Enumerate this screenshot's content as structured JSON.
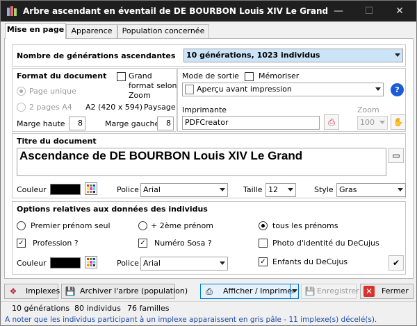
{
  "window": {
    "title": "Arbre ascendant en éventail de DE BOURBON Louis XIV Le Grand"
  },
  "tabs": [
    {
      "label": "Mise en page",
      "active": true
    },
    {
      "label": "Apparence",
      "active": false
    },
    {
      "label": "Population concernée",
      "active": false
    }
  ],
  "generations": {
    "label": "Nombre de générations ascendantes",
    "value": "10 générations, 1023 individus"
  },
  "format": {
    "heading": "Format du document",
    "grand_format_label": "Grand format selon Zoom",
    "page_unique": "Page unique",
    "pages_a4": "2 pages A4",
    "paper": "A2 (420 x 594)",
    "orientation": "Paysage",
    "marge_haute_label": "Marge haute",
    "marge_haute": "8",
    "marge_gauche_label": "Marge gauche",
    "marge_gauche": "8"
  },
  "output": {
    "mode_label": "Mode de sortie",
    "memoriser_label": "Mémoriser",
    "mode_value": "Aperçu avant impression",
    "printer_label": "Imprimante",
    "printer_value": "PDFCreator",
    "zoom_label": "Zoom",
    "zoom_value": "100"
  },
  "title_doc": {
    "heading": "Titre du document",
    "value": "Ascendance de DE BOURBON Louis XIV Le Grand",
    "couleur_label": "Couleur",
    "police_label": "Police",
    "police_value": "Arial",
    "taille_label": "Taille",
    "taille_value": "12",
    "style_label": "Style",
    "style_value": "Gras"
  },
  "options": {
    "heading": "Options relatives aux données des individus",
    "premier_prenom": "Premier prénom seul",
    "deuxieme_prenom": "+ 2ème prénom",
    "tous_prenoms": "tous les prénoms",
    "profession": "Profession ?",
    "numero_sosa": "Numéro Sosa ?",
    "photo_decujus": "Photo d'identité du DeCujus",
    "enfants_decujus": "Enfants du DeCujus",
    "couleur_label": "Couleur",
    "police_label": "Police",
    "police_value": "Arial"
  },
  "buttons": {
    "implexes": "Implexes",
    "archiver": "Archiver l'arbre (population)",
    "afficher": "Afficher / Imprimer",
    "enregistrer": "Enregistrer",
    "fermer": "Fermer"
  },
  "status": {
    "generations": "10 générations",
    "individus": "80 individus",
    "familles": "76 familles",
    "note": "A noter que les individus participant à un implexe apparaissent en gris pâle - 11 implexe(s) décelé(s)."
  },
  "colors": {
    "accent": "#1f4aa8",
    "selected_bg": "#cce4f7",
    "title_bar": "#1f1f1f"
  }
}
